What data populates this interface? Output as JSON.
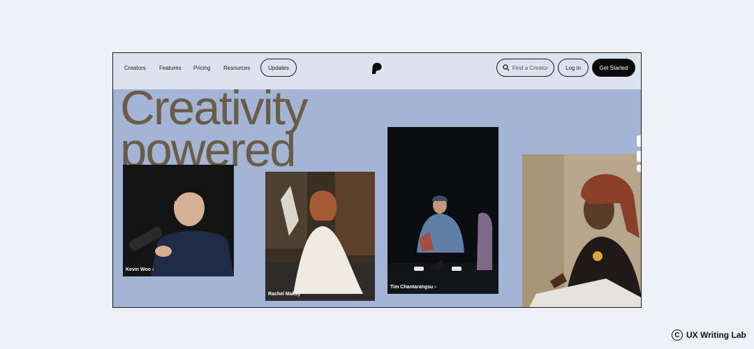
{
  "nav": {
    "links": [
      "Creators",
      "Features",
      "Pricing",
      "Resources"
    ],
    "updates_label": "Updates",
    "search_label": "Find a Creator",
    "login_label": "Log in",
    "cta_label": "Get Started",
    "logo_icon": "patreon-logo-icon"
  },
  "hero": {
    "line1": "Creativity",
    "line2": "powered"
  },
  "creators": [
    {
      "name": "Kevin Woo"
    },
    {
      "name": "Rachel Maksy"
    },
    {
      "name": "Tim Chantarangsu"
    }
  ],
  "footer": {
    "brand": "UX Writing Lab",
    "copyright_symbol": "C"
  },
  "colors": {
    "page_bg": "#edf0f4",
    "nav_bg": "#dde3ee",
    "hero_bg": "#a3b5d4",
    "headline": "#6a5c47",
    "cta_bg": "#0a0a0a"
  }
}
